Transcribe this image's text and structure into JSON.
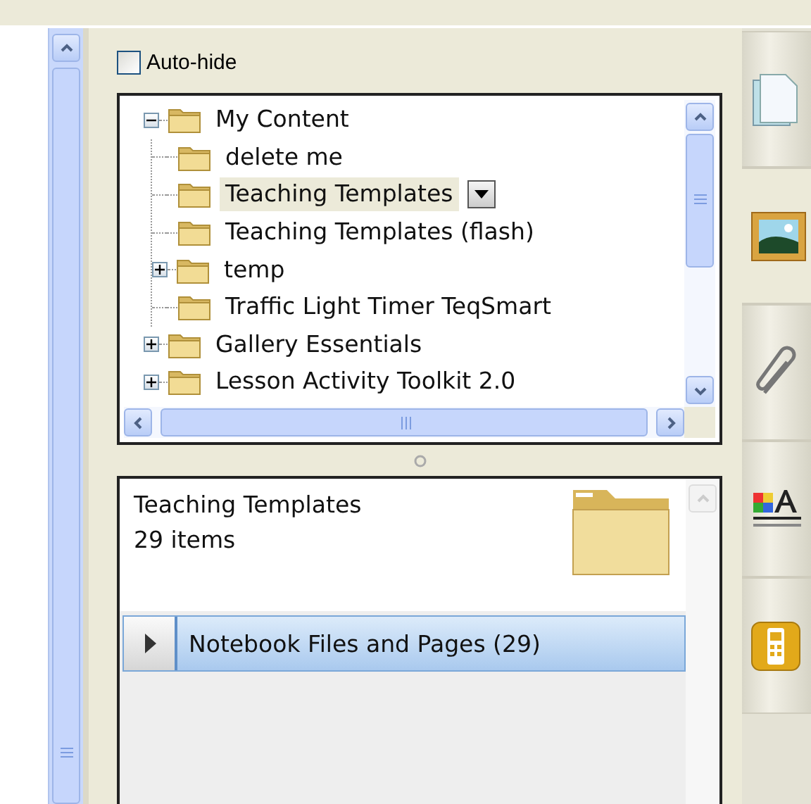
{
  "auto_hide": {
    "label": "Auto-hide",
    "checked": false
  },
  "tree": [
    {
      "label": "My Content",
      "expanded": true,
      "selected": false,
      "children": [
        {
          "label": "delete me",
          "selected": false
        },
        {
          "label": "Teaching Templates",
          "selected": true
        },
        {
          "label": "Teaching Templates (flash)",
          "selected": false
        },
        {
          "label": "temp",
          "expanded": false,
          "selected": false
        },
        {
          "label": "Traffic Light Timer TeqSmart",
          "selected": false
        }
      ]
    },
    {
      "label": "Gallery Essentials",
      "expanded": false,
      "selected": false
    },
    {
      "label": "Lesson Activity Toolkit 2.0",
      "expanded": false,
      "selected": false
    }
  ],
  "details": {
    "title": "Teaching Templates",
    "count": "29 items"
  },
  "groups": [
    {
      "label": "Notebook Files and Pages (29)",
      "expanded": false
    }
  ],
  "side_tabs": [
    {
      "kind": "page",
      "selected": false
    },
    {
      "kind": "picture",
      "selected": true
    },
    {
      "kind": "attachment",
      "selected": false
    },
    {
      "kind": "properties",
      "selected": false
    },
    {
      "kind": "phone",
      "selected": false
    }
  ]
}
